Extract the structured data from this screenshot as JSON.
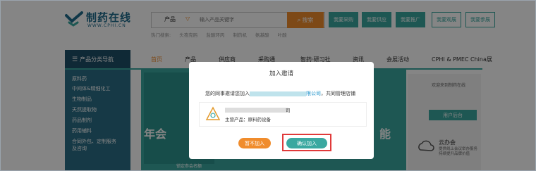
{
  "header": {
    "logo_title": "制药在线",
    "logo_sub": "WWW.CPHI.CN",
    "search": {
      "category": "产品",
      "placeholder": "输入产品关键字",
      "button_label": "搜索"
    },
    "buttons": [
      "我要采购",
      "我要供应",
      "我要推广",
      "我要观展",
      "我要参展"
    ],
    "hot_label": "热门搜索:",
    "hot_terms": [
      "头孢克肟",
      "盐酸环丙",
      "制药机",
      "氨基酸",
      "叶酸"
    ]
  },
  "nav": {
    "category_label": "产品分类导航",
    "items": [
      "首页",
      "产品",
      "供应商",
      "采购通",
      "智药·研习社",
      "资讯",
      "会展活动",
      "CPHI & PMEC China展"
    ]
  },
  "categories": [
    "原料药",
    "中间体&精细化工",
    "生物制品",
    "天然提取物",
    "药品制剂",
    "药用辅料",
    "合同外包、定制服务",
    "及咨询"
  ],
  "banner": {
    "left_text": "年会",
    "right_text": "，能",
    "small_text": "锁定参会名额"
  },
  "right_panel": {
    "user_text": "欢迎来到制药在线",
    "backend_button": "用户后台",
    "cloud_title": "云办会",
    "cloud_desc": "提供线上会议举办服务 持续提升品牌价值"
  },
  "modal": {
    "title": "加入邀请",
    "message_prefix": "您的同事邀请您加入",
    "company_suffix": "限公司",
    "message_suffix": "，共同管理店铺",
    "card_name_suffix": "司",
    "main_product_label": "主营产品：",
    "main_product": "原料药设备",
    "later_button": "暂不加入",
    "confirm_button": "确认加入"
  },
  "colors": {
    "teal": "#3aa8a0",
    "orange": "#f08c2c",
    "navy": "#1e4f69",
    "highlight_red": "#e03a3a"
  }
}
